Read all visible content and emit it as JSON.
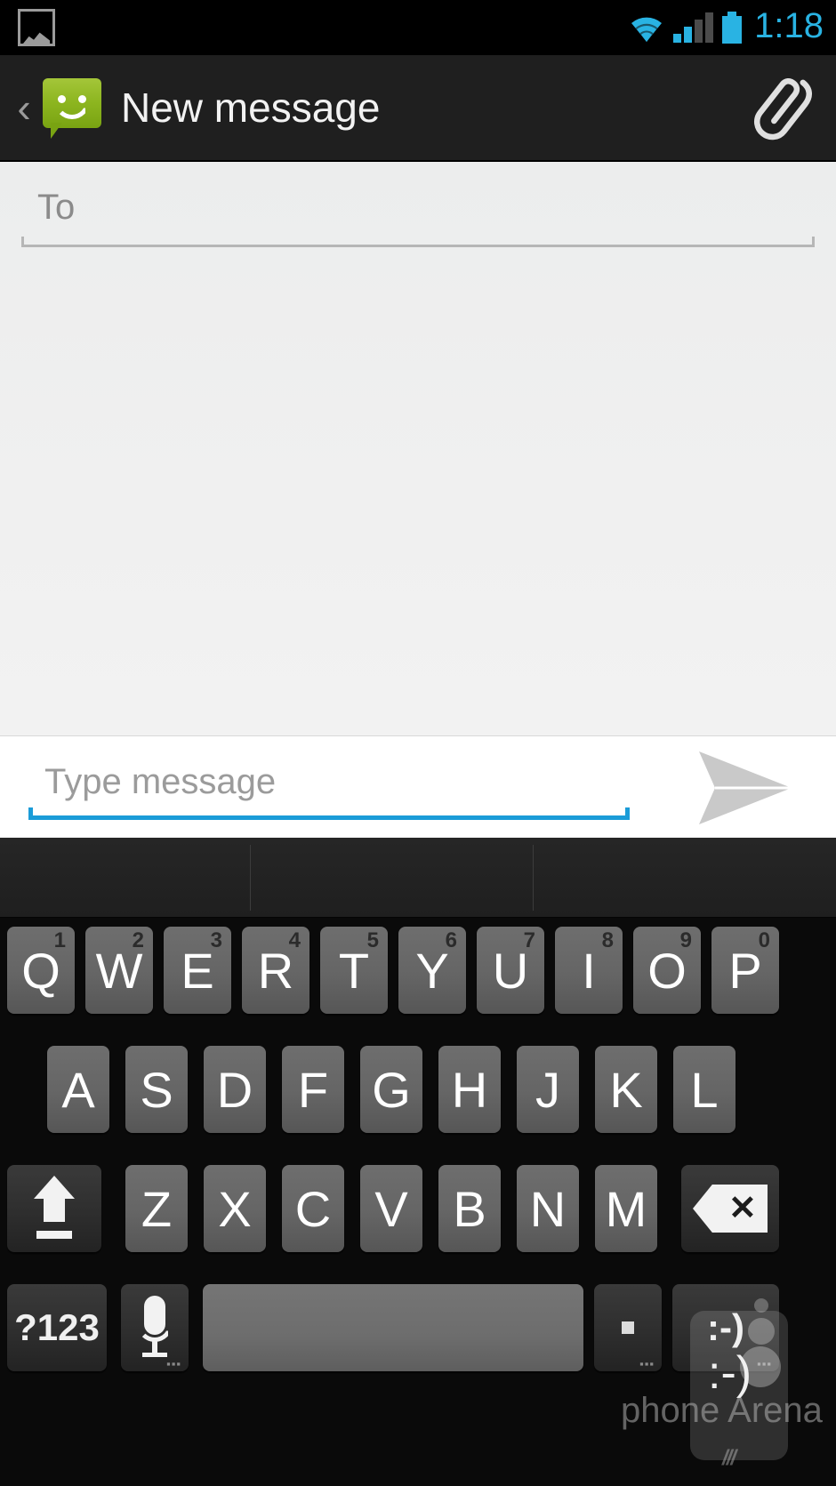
{
  "status_bar": {
    "notification_icon": "image-notification-icon",
    "wifi_icon": "wifi-icon",
    "signal_icon": "signal-bars-icon",
    "signal_bars_active": 2,
    "signal_bars_total": 4,
    "battery_icon": "battery-icon",
    "time": "1:18",
    "accent_color": "#29b3e3"
  },
  "action_bar": {
    "back_chevron": "‹",
    "app_icon": "messaging-app-icon",
    "title": "New message",
    "attach_icon": "paperclip-icon",
    "background": "#1f1f1f"
  },
  "compose": {
    "to_placeholder": "To",
    "to_value": "",
    "message_placeholder": "Type message",
    "message_value": "",
    "send_icon": "send-arrow-icon",
    "focus_underline_color": "#1b9cd8"
  },
  "keyboard": {
    "suggestions": [
      "",
      "",
      ""
    ],
    "rows": [
      [
        {
          "label": "Q",
          "num": "1"
        },
        {
          "label": "W",
          "num": "2"
        },
        {
          "label": "E",
          "num": "3"
        },
        {
          "label": "R",
          "num": "4"
        },
        {
          "label": "T",
          "num": "5"
        },
        {
          "label": "Y",
          "num": "6"
        },
        {
          "label": "U",
          "num": "7"
        },
        {
          "label": "I",
          "num": "8"
        },
        {
          "label": "O",
          "num": "9"
        },
        {
          "label": "P",
          "num": "0"
        }
      ],
      [
        {
          "label": "A"
        },
        {
          "label": "S"
        },
        {
          "label": "D"
        },
        {
          "label": "F"
        },
        {
          "label": "G"
        },
        {
          "label": "H"
        },
        {
          "label": "J"
        },
        {
          "label": "K"
        },
        {
          "label": "L"
        }
      ],
      [
        {
          "label": "",
          "icon": "shift-icon"
        },
        {
          "label": "Z"
        },
        {
          "label": "X"
        },
        {
          "label": "C"
        },
        {
          "label": "V"
        },
        {
          "label": "B"
        },
        {
          "label": "N"
        },
        {
          "label": "M"
        },
        {
          "label": "",
          "icon": "backspace-icon"
        }
      ],
      [
        {
          "label": "?123"
        },
        {
          "label": "",
          "icon": "microphone-icon"
        },
        {
          "label": "",
          "icon": "spacebar"
        },
        {
          "label": "",
          "icon": "period-icon"
        },
        {
          "label": ":-)",
          "icon": "emoji-icon"
        }
      ]
    ],
    "symbols_label": "?123",
    "emoji_label": ":-)",
    "key_color": "#656565",
    "key_dark_color": "#2e2e2e",
    "background": "#0a0a0a"
  },
  "watermark": {
    "text": "phone Arena",
    "emoji": ":-)",
    "slashes": "///"
  }
}
